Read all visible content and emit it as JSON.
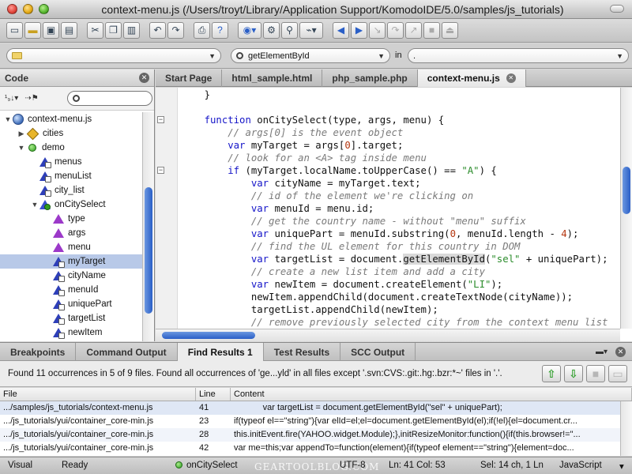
{
  "window": {
    "title": "context-menu.js (/Users/troyt/Library/Application Support/KomodoIDE/5.0/samples/js_tutorials)"
  },
  "toolbar": {
    "icons": [
      "new-file-icon",
      "open-folder-icon",
      "save-icon",
      "save-all-icon",
      "cut-icon",
      "copy-icon",
      "paste-icon",
      "undo-icon",
      "redo-icon",
      "print-icon",
      "help-icon",
      "browser-preview-icon",
      "debug-icon",
      "find-icon",
      "macro-icon",
      "back-icon",
      "forward-icon",
      "step-in-icon",
      "step-over-icon",
      "step-out-icon",
      "stop-icon",
      "detach-icon"
    ]
  },
  "findbar": {
    "location_value": "",
    "search_value": "getElementById",
    "in_label": "in",
    "in_value": "."
  },
  "code_panel": {
    "title": "Code",
    "tree": [
      {
        "label": "context-menu.js",
        "indent": 0,
        "twist": "▼",
        "icon": "globe",
        "name": "tree-file-context-menu"
      },
      {
        "label": "cities",
        "indent": 1,
        "twist": "▶",
        "icon": "diamond",
        "name": "tree-item-cities"
      },
      {
        "label": "demo",
        "indent": 1,
        "twist": "▼",
        "icon": "dot",
        "name": "tree-item-demo"
      },
      {
        "label": "menus",
        "indent": 2,
        "twist": "",
        "icon": "var2",
        "name": "tree-item-menus"
      },
      {
        "label": "menuList",
        "indent": 2,
        "twist": "",
        "icon": "var2",
        "name": "tree-item-menulist"
      },
      {
        "label": "city_list",
        "indent": 2,
        "twist": "",
        "icon": "var2",
        "name": "tree-item-city-list"
      },
      {
        "label": "onCitySelect",
        "indent": 2,
        "twist": "▼",
        "icon": "fn",
        "name": "tree-item-oncityselect"
      },
      {
        "label": "type",
        "indent": 3,
        "twist": "",
        "icon": "var",
        "name": "tree-item-type"
      },
      {
        "label": "args",
        "indent": 3,
        "twist": "",
        "icon": "var",
        "name": "tree-item-args"
      },
      {
        "label": "menu",
        "indent": 3,
        "twist": "",
        "icon": "var",
        "name": "tree-item-menu"
      },
      {
        "label": "myTarget",
        "indent": 3,
        "twist": "",
        "icon": "var2",
        "name": "tree-item-mytarget",
        "selected": true
      },
      {
        "label": "cityName",
        "indent": 3,
        "twist": "",
        "icon": "var2",
        "name": "tree-item-cityname"
      },
      {
        "label": "menuId",
        "indent": 3,
        "twist": "",
        "icon": "var2",
        "name": "tree-item-menuid"
      },
      {
        "label": "uniquePart",
        "indent": 3,
        "twist": "",
        "icon": "var2",
        "name": "tree-item-uniquepart"
      },
      {
        "label": "targetList",
        "indent": 3,
        "twist": "",
        "icon": "var2",
        "name": "tree-item-targetlist"
      },
      {
        "label": "newItem",
        "indent": 3,
        "twist": "",
        "icon": "var2",
        "name": "tree-item-newitem"
      }
    ]
  },
  "editor": {
    "tabs": [
      {
        "label": "Start Page",
        "active": false
      },
      {
        "label": "html_sample.html",
        "active": false
      },
      {
        "label": "php_sample.php",
        "active": false
      },
      {
        "label": "context-menu.js",
        "active": true
      }
    ],
    "lines": [
      [
        {
          "t": "    }",
          "c": ""
        }
      ],
      [
        {
          "t": "",
          "c": ""
        }
      ],
      [
        {
          "t": "    ",
          "c": ""
        },
        {
          "t": "function",
          "c": "kw"
        },
        {
          "t": " onCitySelect(type, args, menu) {",
          "c": ""
        }
      ],
      [
        {
          "t": "        ",
          "c": ""
        },
        {
          "t": "// args[0] is the event object",
          "c": "cm"
        }
      ],
      [
        {
          "t": "        ",
          "c": ""
        },
        {
          "t": "var",
          "c": "kw"
        },
        {
          "t": " myTarget = args[",
          "c": ""
        },
        {
          "t": "0",
          "c": "nm"
        },
        {
          "t": "].target;",
          "c": ""
        }
      ],
      [
        {
          "t": "        ",
          "c": ""
        },
        {
          "t": "// look for an <A> tag inside menu",
          "c": "cm"
        }
      ],
      [
        {
          "t": "        ",
          "c": ""
        },
        {
          "t": "if",
          "c": "kw"
        },
        {
          "t": " (myTarget.localName.toUpperCase() == ",
          "c": ""
        },
        {
          "t": "\"A\"",
          "c": "st"
        },
        {
          "t": ") {",
          "c": ""
        }
      ],
      [
        {
          "t": "            ",
          "c": ""
        },
        {
          "t": "var",
          "c": "kw"
        },
        {
          "t": " cityName = myTarget.text;",
          "c": ""
        }
      ],
      [
        {
          "t": "            ",
          "c": ""
        },
        {
          "t": "// id of the element we're clicking on",
          "c": "cm"
        }
      ],
      [
        {
          "t": "            ",
          "c": ""
        },
        {
          "t": "var",
          "c": "kw"
        },
        {
          "t": " menuId = menu.id;",
          "c": ""
        }
      ],
      [
        {
          "t": "            ",
          "c": ""
        },
        {
          "t": "// get the country name - without \"menu\" suffix",
          "c": "cm"
        }
      ],
      [
        {
          "t": "            ",
          "c": ""
        },
        {
          "t": "var",
          "c": "kw"
        },
        {
          "t": " uniquePart = menuId.substring(",
          "c": ""
        },
        {
          "t": "0",
          "c": "nm"
        },
        {
          "t": ", menuId.length - ",
          "c": ""
        },
        {
          "t": "4",
          "c": "nm"
        },
        {
          "t": ");",
          "c": ""
        }
      ],
      [
        {
          "t": "            ",
          "c": ""
        },
        {
          "t": "// find the UL element for this country in DOM",
          "c": "cm"
        }
      ],
      [
        {
          "t": "            ",
          "c": ""
        },
        {
          "t": "var",
          "c": "kw"
        },
        {
          "t": " targetList = document.",
          "c": ""
        },
        {
          "t": "getElementById",
          "c": "hl"
        },
        {
          "t": "(",
          "c": ""
        },
        {
          "t": "\"sel\"",
          "c": "st"
        },
        {
          "t": " + uniquePart);",
          "c": ""
        }
      ],
      [
        {
          "t": "            ",
          "c": ""
        },
        {
          "t": "// create a new list item and add a city",
          "c": "cm"
        }
      ],
      [
        {
          "t": "            ",
          "c": ""
        },
        {
          "t": "var",
          "c": "kw"
        },
        {
          "t": " newItem = document.createElement(",
          "c": ""
        },
        {
          "t": "\"LI\"",
          "c": "st"
        },
        {
          "t": ");",
          "c": ""
        }
      ],
      [
        {
          "t": "            newItem.appendChild(document.createTextNode(cityName));",
          "c": ""
        }
      ],
      [
        {
          "t": "            targetList.appendChild(newItem);",
          "c": ""
        }
      ],
      [
        {
          "t": "            ",
          "c": ""
        },
        {
          "t": "// remove previously selected city from the context menu list",
          "c": "cm"
        }
      ]
    ]
  },
  "bottom_pane": {
    "tabs": [
      {
        "label": "Breakpoints",
        "active": false
      },
      {
        "label": "Command Output",
        "active": false
      },
      {
        "label": "Find Results 1",
        "active": true
      },
      {
        "label": "Test Results",
        "active": false
      },
      {
        "label": "SCC Output",
        "active": false
      }
    ],
    "summary": "Found 11 occurrences in 5 of 9 files. Found all occurrences of 'ge...yld' in all files except '.svn:CVS:.git:.hg:.bzr:*~' files in '.'.",
    "columns": [
      "File",
      "Line",
      "Content"
    ],
    "rows": [
      {
        "file": ".../samples/js_tutorials/context-menu.js",
        "line": "41",
        "content": "            var targetList = document.getElementById(\"sel\" + uniquePart);"
      },
      {
        "file": ".../js_tutorials/yui/container_core-min.js",
        "line": "23",
        "content": "if(typeof el==\"string\"){var elId=el;el=document.getElementById(el);if(!el){el=document.cr..."
      },
      {
        "file": ".../js_tutorials/yui/container_core-min.js",
        "line": "28",
        "content": "this.initEvent.fire(YAHOO.widget.Module);},initResizeMonitor:function(){if(this.browser!=\"..."
      },
      {
        "file": ".../js_tutorials/yui/container_core-min.js",
        "line": "42",
        "content": "var me=this;var appendTo=function(element){if(typeof element==\"string\"){element=doc..."
      }
    ]
  },
  "statusbar": {
    "mode": "Visual",
    "state": "Ready",
    "symbol": "onCitySelect",
    "watermark": "GEARTOOLBLOG.COM",
    "encoding": "UTF-8",
    "position": "Ln: 41 Col: 53",
    "selection": "Sel: 14 ch, 1 Ln",
    "language": "JavaScript"
  }
}
